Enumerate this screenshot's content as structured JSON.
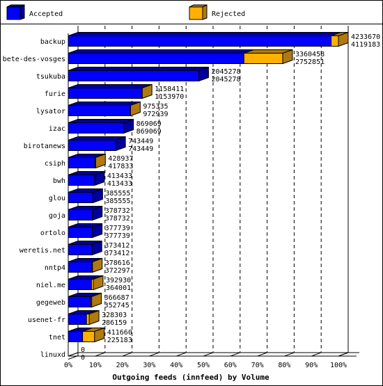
{
  "chart_data": {
    "type": "bar",
    "orientation": "horizontal",
    "stacked": true,
    "style": "3d",
    "title": "Outgoing feeds (innfeed) by Volume",
    "xlabel": "Outgoing feeds (innfeed) by Volume",
    "ylabel": "",
    "xlim_percent": [
      0,
      100
    ],
    "x_ticks": [
      "0%",
      "10%",
      "20%",
      "30%",
      "40%",
      "50%",
      "60%",
      "70%",
      "80%",
      "90%",
      "100%"
    ],
    "grid": "vertical dashed",
    "legend_position": "top",
    "categories": [
      "backup",
      "bete-des-vosges",
      "tsukuba",
      "furie",
      "lysator",
      "izac",
      "birotanews",
      "csiph",
      "bwh",
      "glou",
      "goja",
      "ortolo",
      "weretis.net",
      "nntp4",
      "niel.me",
      "gegeweb",
      "usenet-fr",
      "tnet",
      "linuxd"
    ],
    "totals": [
      4233670,
      3360458,
      2045278,
      1158411,
      975335,
      869069,
      743449,
      428937,
      413433,
      385555,
      378732,
      377739,
      373412,
      378616,
      392930,
      366687,
      328303,
      411660,
      0
    ],
    "series": [
      {
        "name": "Accepted",
        "color": "#0000ff",
        "side_color": "#00009c",
        "values": [
          4119183,
          2752851,
          2045278,
          1153970,
          972939,
          869069,
          743449,
          417833,
          413433,
          385555,
          378732,
          377739,
          373412,
          372297,
          364001,
          352745,
          286159,
          225183,
          0
        ]
      },
      {
        "name": "Rejected",
        "color": "#ffb000",
        "side_color": "#b07a10",
        "values": [
          114487,
          607607,
          0,
          4441,
          2396,
          0,
          0,
          11104,
          0,
          0,
          0,
          0,
          0,
          6319,
          28929,
          13942,
          42144,
          186477,
          0
        ]
      }
    ]
  },
  "legend": {
    "items": [
      {
        "label": "Accepted",
        "color": "#0000ff"
      },
      {
        "label": "Rejected",
        "color": "#ffb000"
      }
    ]
  }
}
